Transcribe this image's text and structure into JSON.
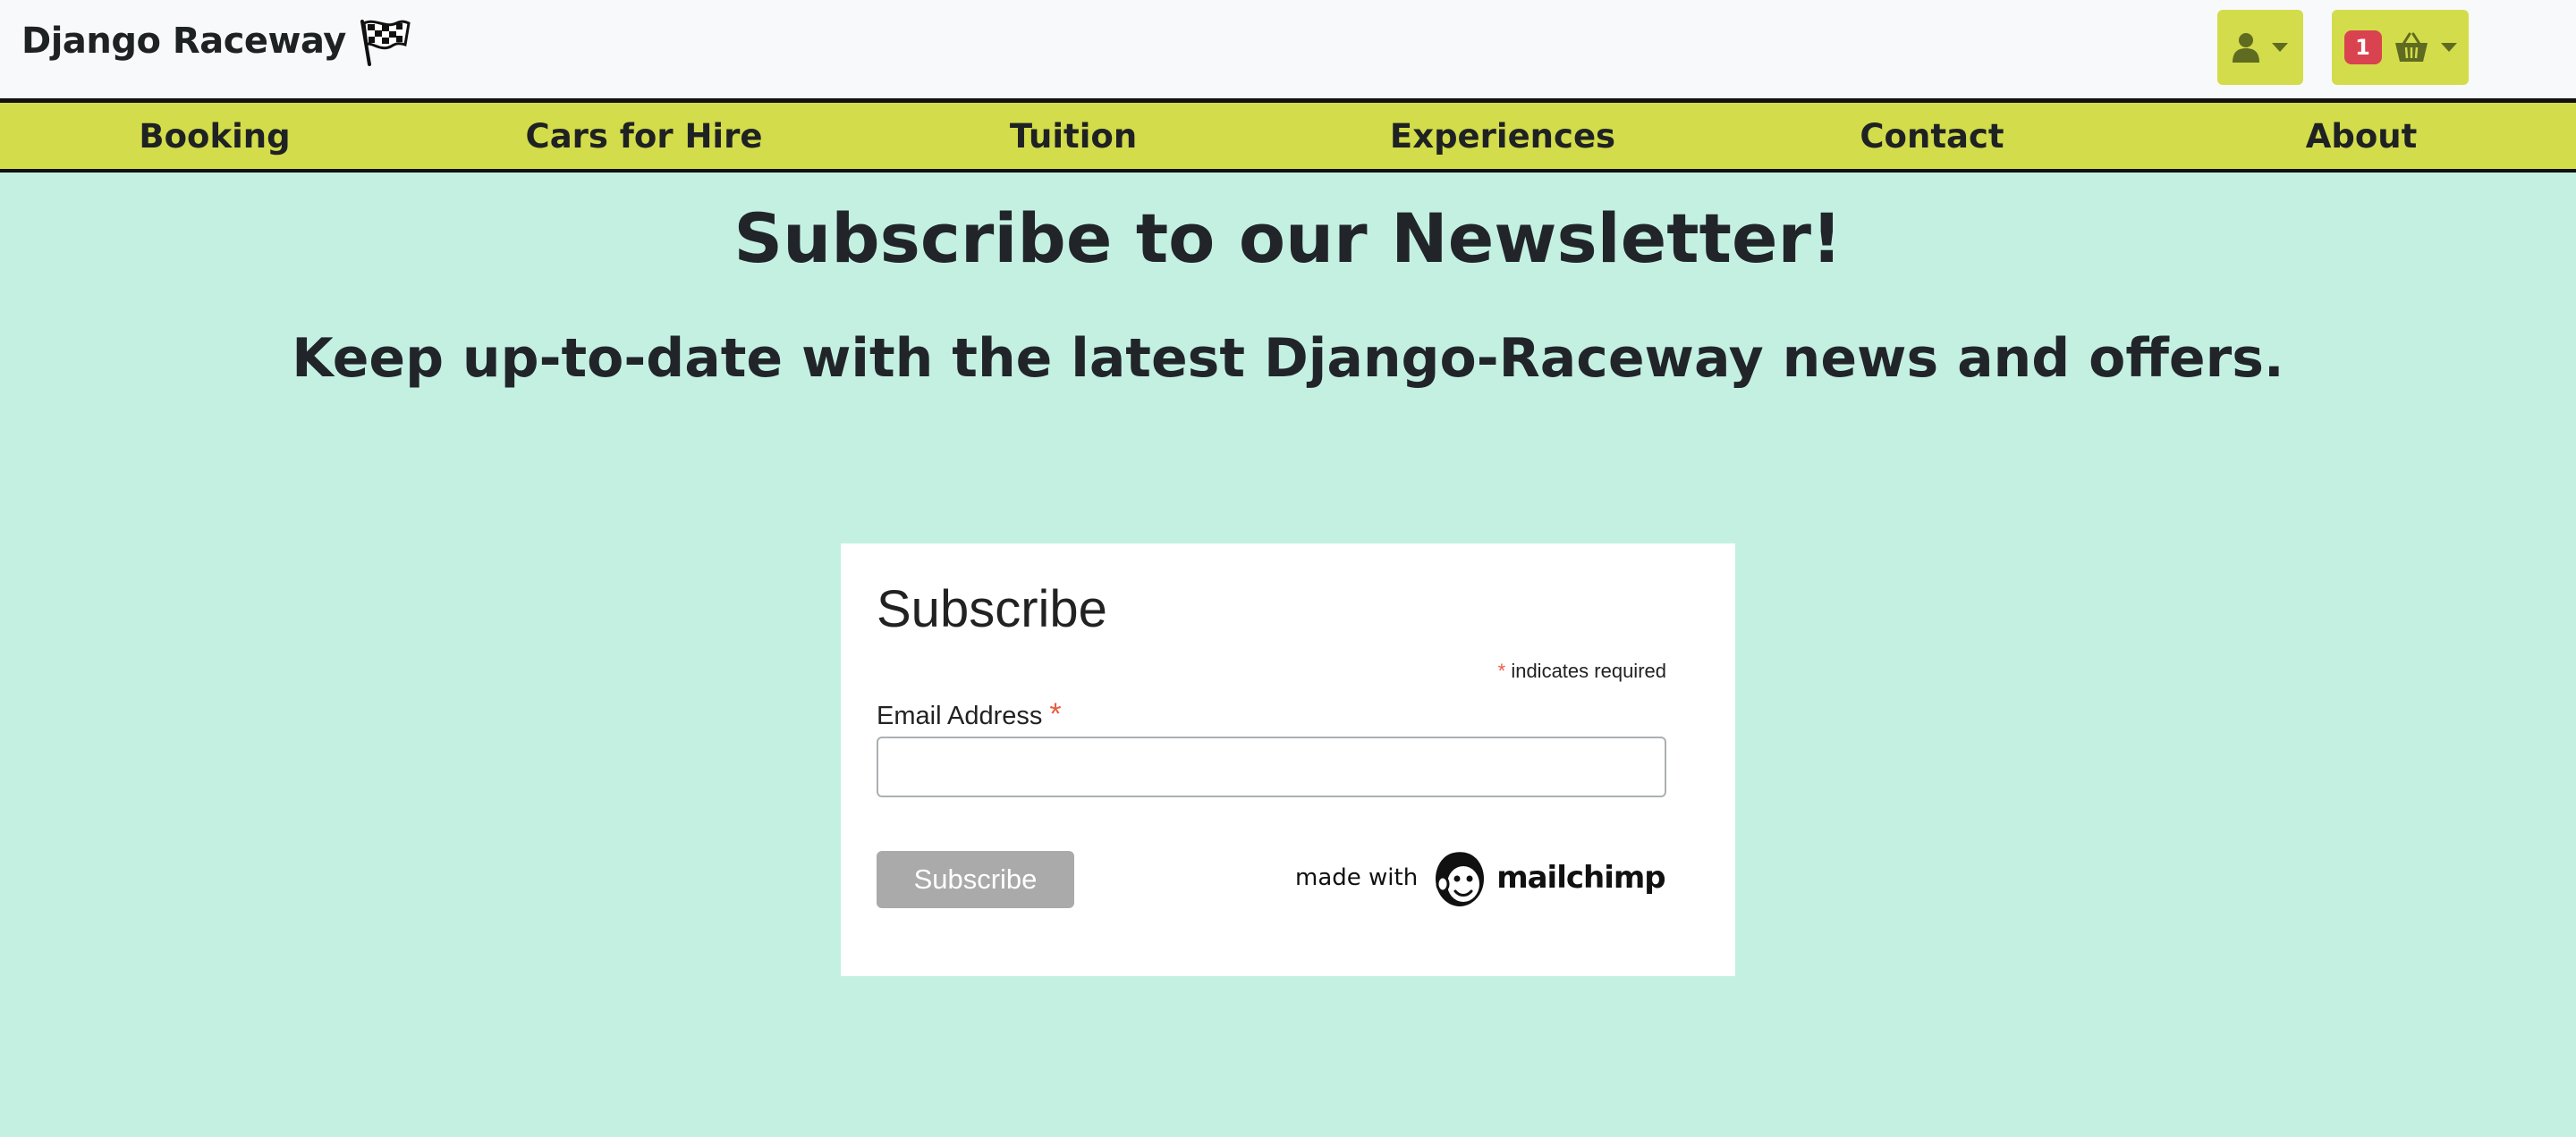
{
  "header": {
    "brand": "Django Raceway",
    "brand_icon": "checkered-flag-icon",
    "account_icon": "user-icon",
    "basket_icon": "basket-icon",
    "basket_count": "1"
  },
  "nav": {
    "items": [
      {
        "label": "Booking"
      },
      {
        "label": "Cars for Hire"
      },
      {
        "label": "Tuition"
      },
      {
        "label": "Experiences"
      },
      {
        "label": "Contact"
      },
      {
        "label": "About"
      }
    ]
  },
  "hero": {
    "title": "Subscribe to our Newsletter!",
    "subtitle": "Keep up-to-date with the latest Django-Raceway news and offers."
  },
  "signup": {
    "title": "Subscribe",
    "required_asterisk": "*",
    "required_note": "indicates required",
    "email_label": "Email Address",
    "email_value": "",
    "email_placeholder": "",
    "submit_label": "Subscribe",
    "made_with": "made with",
    "mailchimp": "mailchimp"
  },
  "colors": {
    "page_background": "#c4f0e2",
    "accent": "#d3dc4a",
    "badge": "#d9434f",
    "button_disabled": "#aaaaaa",
    "required": "#e85c41"
  }
}
